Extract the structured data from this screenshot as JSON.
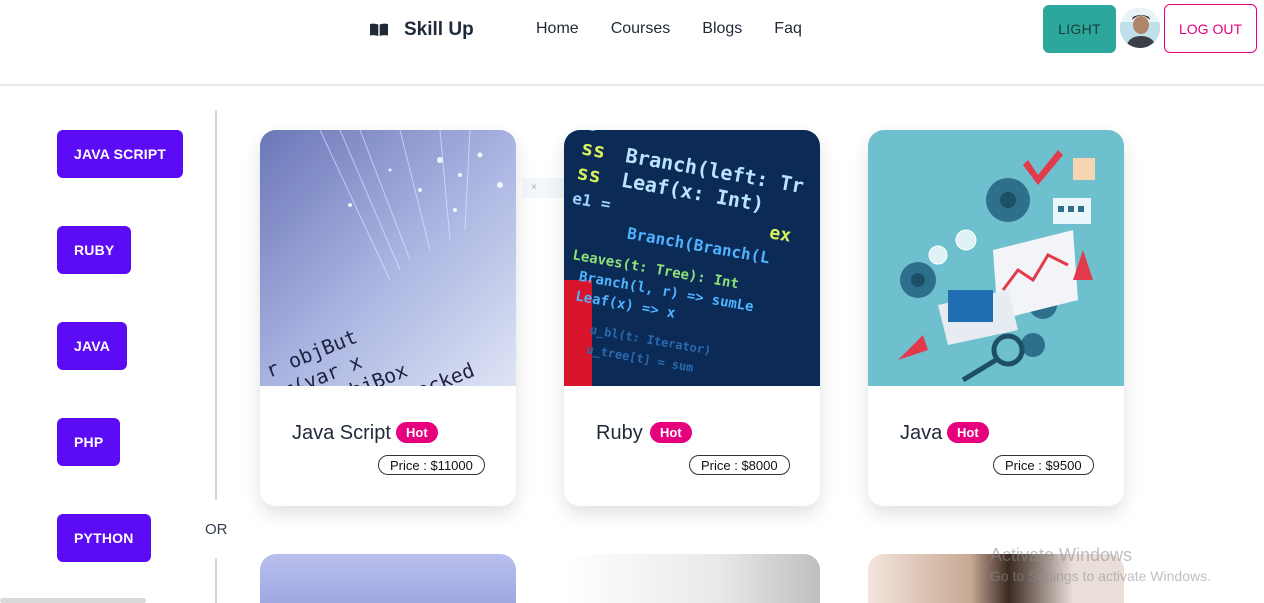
{
  "header": {
    "brand": "Skill Up",
    "brand_icon": "book-open-icon",
    "nav": [
      "Home",
      "Courses",
      "Blogs",
      "Faq"
    ],
    "theme_button": "LIGHT",
    "logout_button": "LOG OUT",
    "avatar_icon": "user-avatar"
  },
  "sidebar": {
    "categories": [
      "JAVA SCRIPT",
      "RUBY",
      "JAVA",
      "PHP",
      "PYTHON"
    ],
    "or_label": "OR"
  },
  "courses": [
    {
      "title": "Java Script",
      "badge": "Hot",
      "price": "Price : $11000",
      "image": "code-fiber-optic"
    },
    {
      "title": "Ruby",
      "badge": "Hot",
      "price": "Price : $8000",
      "image": "code-screen-branch"
    },
    {
      "title": "Java",
      "badge": "Hot",
      "price": "Price : $9500",
      "image": "tech-illustration"
    }
  ],
  "watermark": {
    "line1": "Activate Windows",
    "line2": "Go to Settings to activate Windows."
  },
  "colors": {
    "accent_purple": "#5b0cf5",
    "hot_pink": "#e6007e",
    "teal": "#2ba89b"
  }
}
